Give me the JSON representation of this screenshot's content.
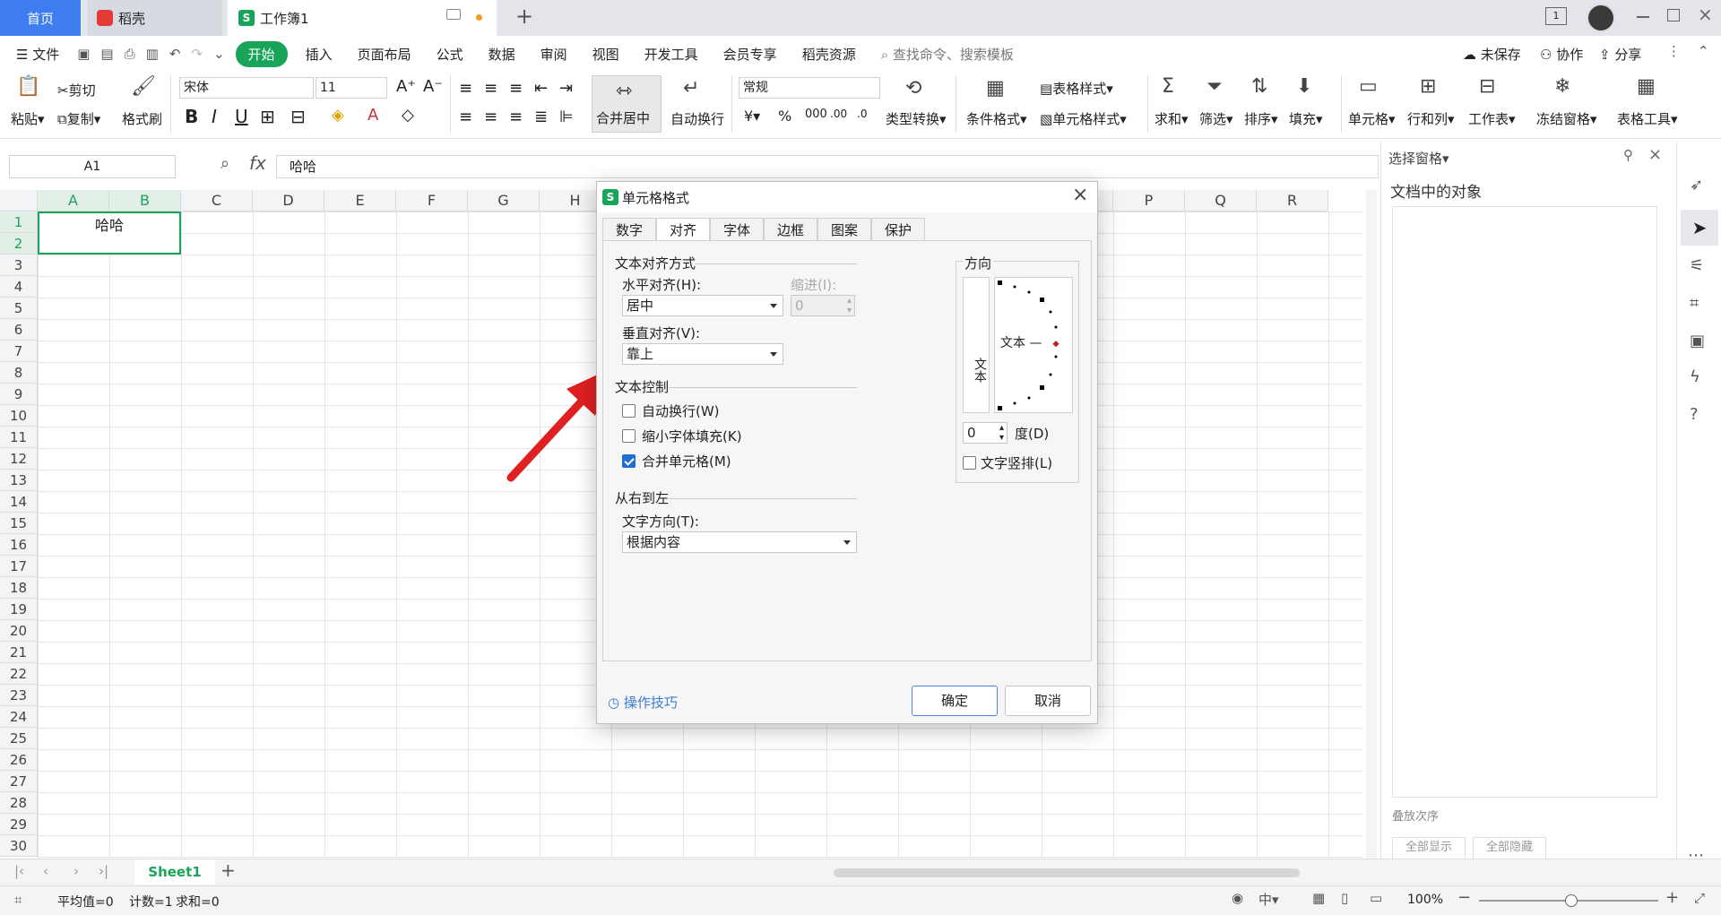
{
  "titlebar": {
    "tab_home": "首页",
    "tab_docer": "稻壳",
    "tab_workbook": "工作簿1",
    "new_tab": "+",
    "page_badge": "1"
  },
  "menubar": {
    "file": "文件",
    "items": [
      "开始",
      "插入",
      "页面布局",
      "公式",
      "数据",
      "审阅",
      "视图",
      "开发工具",
      "会员专享",
      "稻壳资源"
    ],
    "search": "查找命令、搜索模板",
    "unsaved": "未保存",
    "collab": "协作",
    "share": "分享"
  },
  "ribbon": {
    "paste": "粘贴",
    "cut": "剪切",
    "copy": "复制",
    "format_painter": "格式刷",
    "font_name": "宋体",
    "font_size": "11",
    "merge_center": "合并居中",
    "wrap": "自动换行",
    "number_format": "常规",
    "type_convert": "类型转换",
    "cond_format": "条件格式",
    "table_style": "表格样式",
    "cell_style": "单元格样式",
    "sum": "求和",
    "filter": "筛选",
    "sort": "排序",
    "fill": "填充",
    "cell": "单元格",
    "row_col": "行和列",
    "worksheet": "工作表",
    "freeze": "冻结窗格",
    "table_tools": "表格工具"
  },
  "formula": {
    "name_box": "A1",
    "fx": "fx",
    "content": "哈哈"
  },
  "sheet": {
    "columns": [
      "A",
      "B",
      "C",
      "D",
      "E",
      "F",
      "G",
      "H",
      "I",
      "J",
      "K",
      "L",
      "M",
      "N",
      "O",
      "P",
      "Q",
      "R"
    ],
    "rows": [
      "1",
      "2",
      "3",
      "4",
      "5",
      "6",
      "7",
      "8",
      "9",
      "10",
      "11",
      "12",
      "13",
      "14",
      "15",
      "16",
      "17",
      "18",
      "19",
      "20",
      "21",
      "22",
      "23",
      "24",
      "25",
      "26",
      "27",
      "28",
      "29",
      "30"
    ],
    "cell_a1": "哈哈"
  },
  "dialog": {
    "title": "单元格格式",
    "tabs": [
      "数字",
      "对齐",
      "字体",
      "边框",
      "图案",
      "保护"
    ],
    "active_tab": "对齐",
    "text_align_section": "文本对齐方式",
    "horizontal_label": "水平对齐(H):",
    "horizontal_value": "居中",
    "indent_label": "缩进(I):",
    "indent_value": "0",
    "vertical_label": "垂直对齐(V):",
    "vertical_value": "靠上",
    "text_control_section": "文本控制",
    "wrap_label": "自动换行(W)",
    "wrap_checked": false,
    "shrink_label": "缩小字体填充(K)",
    "shrink_checked": false,
    "merge_label": "合并单元格(M)",
    "merge_checked": true,
    "rtl_section": "从右到左",
    "text_dir_label": "文字方向(T):",
    "text_dir_value": "根据内容",
    "orientation_section": "方向",
    "orientation_vertical_text": "文本",
    "orientation_dial_text": "文本 —",
    "degree_value": "0",
    "degree_label": "度(D)",
    "vertical_text_label": "文字竖排(L)",
    "vertical_text_checked": false,
    "tips": "操作技巧",
    "ok": "确定",
    "cancel": "取消"
  },
  "rightpane": {
    "title": "选择窗格",
    "objects_heading": "文档中的对象",
    "show_all": "全部显示",
    "hide_all": "全部隐藏",
    "reorder": "叠放次序"
  },
  "sheettabs": {
    "active": "Sheet1"
  },
  "status": {
    "average": "平均值=0",
    "count": "计数=1",
    "sum": "求和=0",
    "zoom": "100%"
  },
  "colors": {
    "accent_green": "#1aa45a",
    "home_tab_blue": "#3d7df0",
    "arrow_red": "#e02020",
    "checkbox_blue": "#1f6ed8"
  }
}
